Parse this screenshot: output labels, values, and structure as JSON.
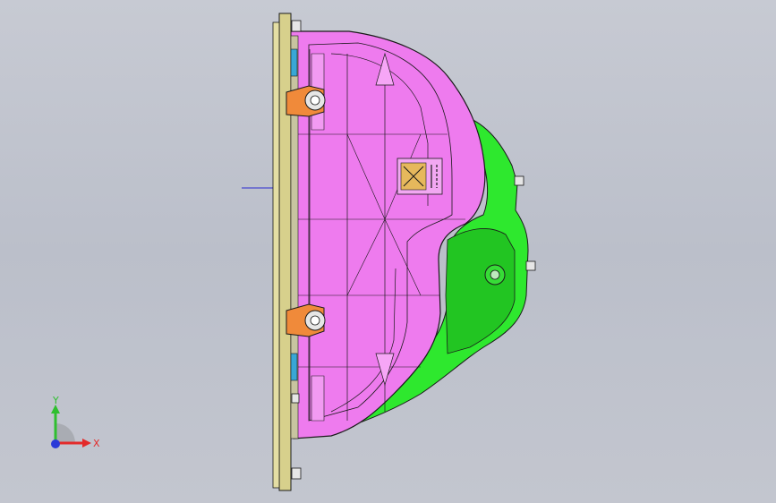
{
  "viewport": {
    "background_top": "#c7cad3",
    "background_bottom": "#c3c6cf"
  },
  "model": {
    "main_color": "#ee7bee",
    "cover_color": "#2ee82e",
    "flange_color": "#d7d08c",
    "bracket_color": "#f08a3a",
    "seal_color": "#39a7d6",
    "outline_color": "#1a1a1a"
  },
  "triad": {
    "x_label": "X",
    "y_label": "Y",
    "x_color": "#e32a2a",
    "y_color": "#2fbf2f",
    "z_color": "#2a3ad8"
  }
}
